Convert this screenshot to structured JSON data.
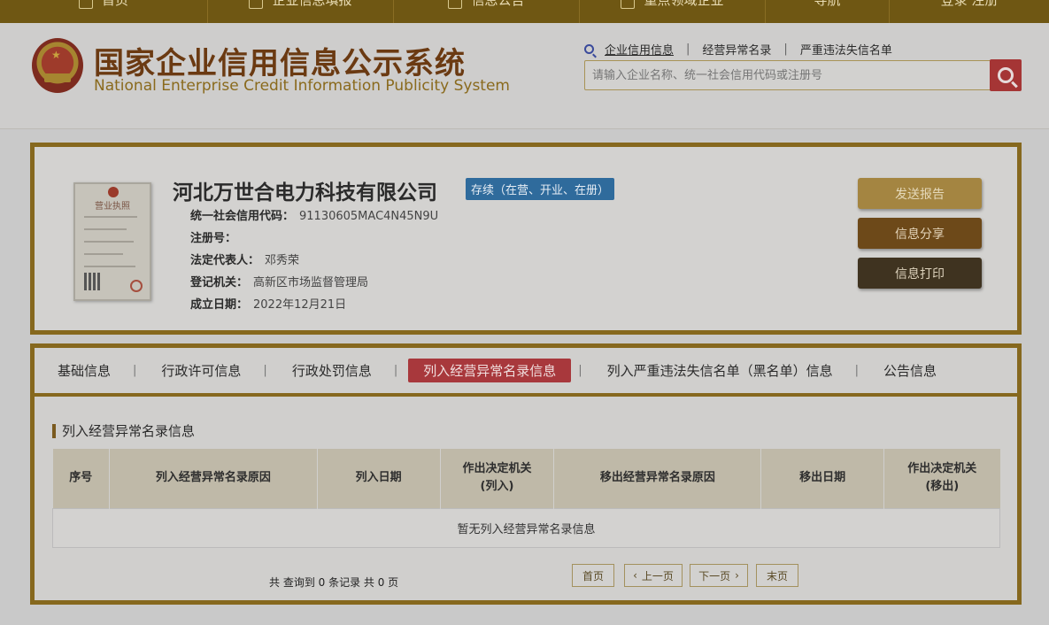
{
  "topnav": {
    "items": [
      "首页",
      "企业信息填报",
      "信息公告",
      "重点领域企业",
      "导航",
      "登录 注册"
    ]
  },
  "header": {
    "title_cn": "国家企业信用信息公示系统",
    "title_en": "National Enterprise Credit Information Publicity System",
    "search_links": [
      "企业信用信息",
      "经营异常名录",
      "严重违法失信名单"
    ],
    "link_separator": "|",
    "search_placeholder": "请输入企业名称、统一社会信用代码或注册号"
  },
  "company": {
    "license_title": "营业执照",
    "name": "河北万世合电力科技有限公司",
    "status": "存续（在营、开业、在册）",
    "fields": [
      {
        "label": "统一社会信用代码：",
        "value": "91130605MAC4N45N9U"
      },
      {
        "label": "注册号：",
        "value": ""
      },
      {
        "label": "法定代表人：",
        "value": "邓秀荣"
      },
      {
        "label": "登记机关：",
        "value": "高新区市场监督管理局"
      },
      {
        "label": "成立日期：",
        "value": "2022年12月21日"
      }
    ],
    "buttons": {
      "report": "发送报告",
      "share": "信息分享",
      "print": "信息打印"
    }
  },
  "tabs": {
    "items": [
      "基础信息",
      "行政许可信息",
      "行政处罚信息",
      "列入经营异常名录信息",
      "列入严重违法失信名单（黑名单）信息",
      "公告信息"
    ],
    "separator": "|",
    "active_index": 3
  },
  "abnormal": {
    "section_title": "列入经营异常名录信息",
    "columns": [
      [
        "序号"
      ],
      [
        "列入经营异常名录原因"
      ],
      [
        "列入日期"
      ],
      [
        "作出决定机关",
        "(列入)"
      ],
      [
        "移出经营异常名录原因"
      ],
      [
        "移出日期"
      ],
      [
        "作出决定机关",
        "(移出)"
      ]
    ],
    "empty_text": "暂无列入经营异常名录信息",
    "summary": "共 查询到 0 条记录 共 0 页",
    "pager": {
      "first": "首页",
      "prev": "上一页",
      "next": "下一页",
      "last": "末页",
      "prev_arrow": "‹",
      "next_arrow": "›"
    }
  },
  "colors": {
    "nav_bg": "#6f5713",
    "border_gold": "#86681e",
    "active_tab": "#a8383c",
    "status_badge": "#2f6b9c",
    "search_button": "#a53535"
  }
}
